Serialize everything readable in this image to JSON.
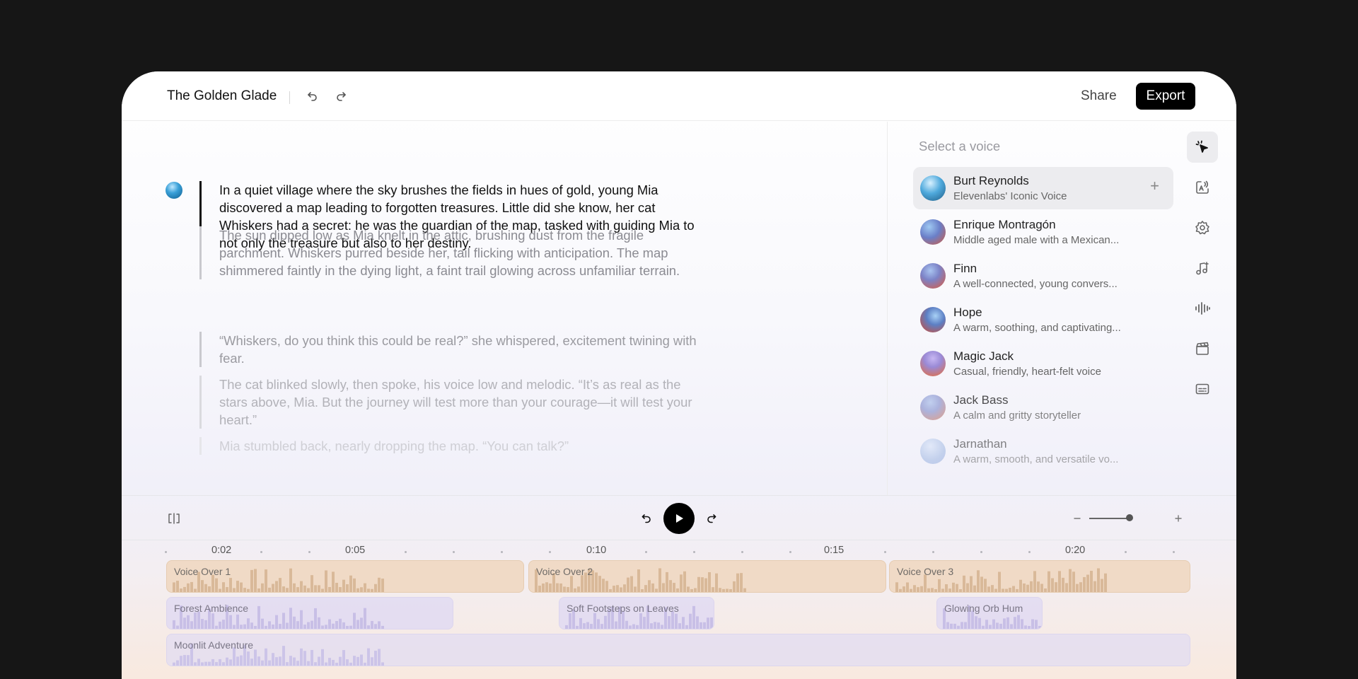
{
  "project": {
    "title": "The Golden Glade"
  },
  "header": {
    "share_label": "Share",
    "export_label": "Export",
    "undo_icon": "undo-icon",
    "redo_icon": "redo-icon"
  },
  "editor": {
    "paragraphs": [
      "In a quiet village where the sky brushes the fields in hues of gold, young Mia discovered a map leading to forgotten treasures. Little did she know, her cat Whiskers had a secret: he was the guardian of the map, tasked with guiding Mia to not only the treasure but also to her destiny.",
      "The sun dipped low as Mia knelt in the attic, brushing dust from the fragile parchment. Whiskers purred beside her, tail flicking with anticipation. The map shimmered faintly in the dying light, a faint trail glowing across unfamiliar terrain.",
      "“Whiskers, do you think this could be real?” she whispered, excitement twining with fear.",
      "The cat blinked slowly, then spoke, his voice low and melodic. “It’s as real as the stars above, Mia. But the journey will test more than your courage—it will test your heart.”",
      "Mia stumbled back, nearly dropping the map. “You can talk?”"
    ]
  },
  "voice_panel": {
    "title": "Select a voice",
    "voices": [
      {
        "name": "Burt Reynolds",
        "desc": "Elevenlabs' Iconic Voice",
        "selected": true
      },
      {
        "name": "Enrique Montragón",
        "desc": "Middle aged male with a Mexican..."
      },
      {
        "name": "Finn",
        "desc": "A well-connected, young convers..."
      },
      {
        "name": "Hope",
        "desc": "A warm, soothing, and captivating..."
      },
      {
        "name": "Magic Jack",
        "desc": "Casual, friendly, heart-felt voice"
      },
      {
        "name": "Jack Bass",
        "desc": "A calm and gritty storyteller"
      },
      {
        "name": "Jarnathan",
        "desc": "A warm, smooth, and versatile vo..."
      }
    ],
    "add_icon": "plus-icon"
  },
  "tools": [
    "cursor-select-icon",
    "text-to-speech-icon",
    "settings-icon",
    "music-icon",
    "waveform-icon",
    "clapperboard-icon",
    "subtitles-icon"
  ],
  "transport": {
    "zoom_level": 0.8
  },
  "timeline": {
    "time_labels": [
      "0:02",
      "0:05",
      "0:10",
      "0:15",
      "0:20"
    ],
    "tracks": [
      {
        "type": "voice",
        "clips": [
          "Voice Over 1",
          "Voice Over 2",
          "Voice Over 3"
        ]
      },
      {
        "type": "sfx",
        "clips": [
          "Forest Ambience",
          "Soft Footsteps on Leaves",
          "Glowing Orb Hum"
        ]
      },
      {
        "type": "music",
        "clips": [
          "Moonlit Adventure"
        ]
      }
    ]
  },
  "colors": {
    "accent": "#000000",
    "voice_clip": "#eed6be",
    "sfx_clip": "#e0daf2",
    "background": "#161616"
  }
}
